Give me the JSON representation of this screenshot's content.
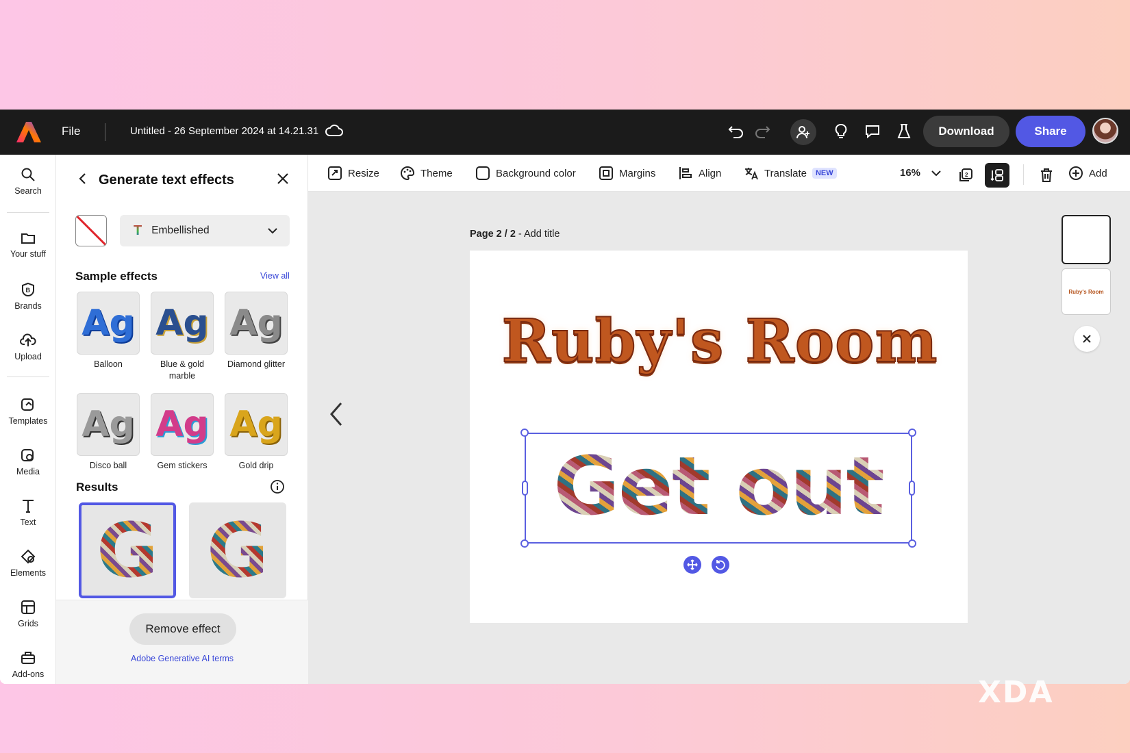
{
  "app": {
    "file_menu": "File",
    "doc_title": "Untitled - 26 September 2024 at 14.21.31",
    "download": "Download",
    "share": "Share",
    "accent_color": "#5258e4"
  },
  "rail": {
    "items": [
      {
        "label": "Search",
        "icon": "search-icon"
      },
      {
        "label": "Your stuff",
        "icon": "folder-icon"
      },
      {
        "label": "Brands",
        "icon": "brands-icon"
      },
      {
        "label": "Upload",
        "icon": "upload-icon"
      },
      {
        "label": "Templates",
        "icon": "templates-icon"
      },
      {
        "label": "Media",
        "icon": "media-icon"
      },
      {
        "label": "Text",
        "icon": "text-icon"
      },
      {
        "label": "Elements",
        "icon": "elements-icon"
      },
      {
        "label": "Grids",
        "icon": "grids-icon"
      },
      {
        "label": "Add-ons",
        "icon": "addons-icon"
      }
    ]
  },
  "panel": {
    "title": "Generate text effects",
    "style_value": "Embellished",
    "sample_effects_heading": "Sample effects",
    "view_all": "View all",
    "effects": [
      {
        "label": "Balloon",
        "glyph": "Ag"
      },
      {
        "label": "Blue & gold marble",
        "glyph": "Ag"
      },
      {
        "label": "Diamond glitter",
        "glyph": "Ag"
      },
      {
        "label": "Disco ball",
        "glyph": "Ag"
      },
      {
        "label": "Gem stickers",
        "glyph": "Ag"
      },
      {
        "label": "Gold drip",
        "glyph": "Ag"
      }
    ],
    "results_heading": "Results",
    "results": [
      {
        "glyph": "G",
        "selected": true
      },
      {
        "glyph": "G",
        "selected": false
      }
    ],
    "remove_effect": "Remove effect",
    "ai_terms": "Adobe Generative AI terms"
  },
  "toolbar": {
    "resize": "Resize",
    "theme": "Theme",
    "background_color": "Background color",
    "margins": "Margins",
    "align": "Align",
    "translate": "Translate",
    "new_badge": "NEW",
    "zoom": "16%",
    "add": "Add"
  },
  "canvas": {
    "page_label_num": "Page 2 / 2",
    "page_label_sep": " - ",
    "page_title_placeholder": "Add title",
    "heading_text": "Ruby's Room",
    "body_text": "Get out",
    "thumb2_text": "Ruby's Room"
  },
  "watermark": "XDA"
}
